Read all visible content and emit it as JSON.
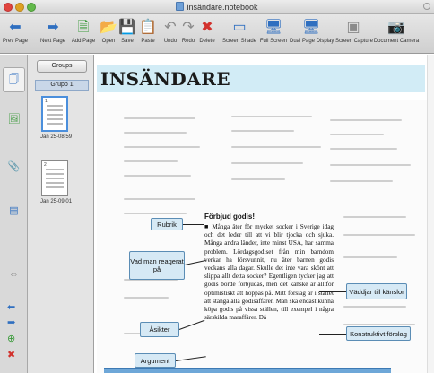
{
  "window": {
    "title": "insändare.notebook"
  },
  "toolbar": {
    "buttons": [
      {
        "label": "Prev Page",
        "icon": "arrow-left-icon"
      },
      {
        "label": "Next Page",
        "icon": "arrow-right-icon"
      },
      {
        "label": "Add Page",
        "icon": "add-page-icon"
      },
      {
        "label": "Open",
        "icon": "folder-open-icon"
      },
      {
        "label": "Save",
        "icon": "save-icon"
      },
      {
        "label": "Paste",
        "icon": "paste-icon"
      },
      {
        "label": "Undo",
        "icon": "undo-icon"
      },
      {
        "label": "Redo",
        "icon": "redo-icon"
      },
      {
        "label": "Delete",
        "icon": "delete-icon"
      },
      {
        "label": "Screen Shade",
        "icon": "screen-shade-icon"
      },
      {
        "label": "Full Screen",
        "icon": "full-screen-icon"
      },
      {
        "label": "Dual Page Display",
        "icon": "dual-page-icon"
      },
      {
        "label": "Screen Capture",
        "icon": "screen-capture-icon"
      },
      {
        "label": "Document Camera",
        "icon": "document-camera-icon"
      }
    ]
  },
  "sorter": {
    "groups_label": "Groups",
    "group_name": "Grupp 1",
    "pages": [
      {
        "number": "1",
        "timestamp": "Jan 25-08:59"
      },
      {
        "number": "2",
        "timestamp": "Jan 25-09:01"
      }
    ]
  },
  "canvas": {
    "banner_title": "INSÄNDARE",
    "article_heading": "Förbjud godis!",
    "article_text": "■ Många äter för mycket socker i Sverige idag och det leder till att vi blir tjocka och sjuka. Många andra länder, inte minst USA, har samma problem. Lördagsgodiset från min barndom verkar ha försvunnit, nu äter barnen godis veckans alla dagar. Skulle det inte vara skönt att slippa allt detta socker? Egentligen tycker jag att godis borde förbjudas, men det kanske är alltför optimistiskt att hoppas på. Mitt förslag är i stället att stänga alla godisaffärer. Man ska endast kunna köpa godis på vissa ställen, till exempel i några särskilda maraffärer. Då",
    "callouts": [
      {
        "label": "Rubrik"
      },
      {
        "label": "Vad man reagerat på"
      },
      {
        "label": "Väddjar till känslor"
      },
      {
        "label": "Åsikter"
      },
      {
        "label": "Konstruktivt förslag"
      },
      {
        "label": "Argument"
      }
    ]
  },
  "colors": {
    "banner": "#d2ecf6",
    "callout_fill": "#d6e9f5",
    "callout_border": "#5b8db5",
    "accent": "#2f6fc0"
  }
}
